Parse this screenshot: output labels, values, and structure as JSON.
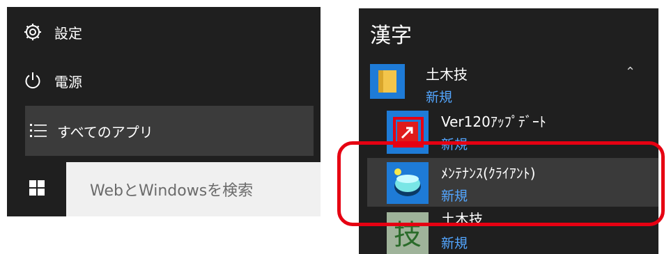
{
  "start_menu": {
    "settings_label": "設定",
    "power_label": "電源",
    "all_apps_label": "すべてのアプリ",
    "search_placeholder": "WebとWindowsを検索"
  },
  "app_list": {
    "group_header": "漢字",
    "folder": {
      "name": "土木技",
      "tag": "新規",
      "collapse_icon": "chevron-up-icon"
    },
    "items": [
      {
        "name": "Ver120ｱｯﾌﾟﾃﾞｰﾄ",
        "tag": "新規",
        "icon": "shortcut-arrow-icon"
      },
      {
        "name": "ﾒﾝﾃﾅﾝｽ(ｸﾗｲｱﾝﾄ)",
        "tag": "新規",
        "icon": "maintenance-icon"
      },
      {
        "name": "土木技",
        "tag": "新規",
        "icon": "kanji-tile-icon",
        "tile_glyph": "技"
      }
    ]
  },
  "colors": {
    "panel_bg": "#1f1f1f",
    "tile_blue": "#1e7bd7",
    "tag_blue": "#53a6ff",
    "highlight_red": "#e60012"
  }
}
